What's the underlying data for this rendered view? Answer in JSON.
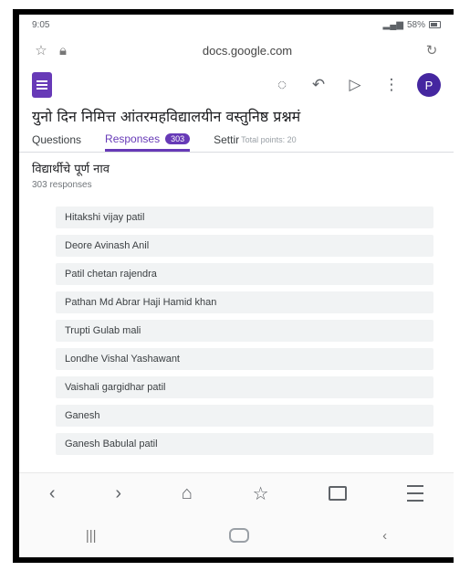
{
  "status_bar": {
    "time": "9:05",
    "right": "58%"
  },
  "browser": {
    "url": "docs.google.com"
  },
  "toolbar": {
    "avatar_letter": "P"
  },
  "form": {
    "title": "युनो दिन निमित्त आंतरमहविद्यालयीन वस्तुनिष्ठ प्रश्नमं"
  },
  "tabs": {
    "questions": "Questions",
    "responses": "Responses",
    "response_count": "303",
    "settings_cut": "Settir",
    "total_points": "Total points: 20"
  },
  "question": {
    "title": "विद्यार्थीचे पूर्ण नाव",
    "responses_label": "303 responses",
    "answers": [
      "Hitakshi vijay patil",
      "Deore Avinash Anil",
      "Patil chetan rajendra",
      "Pathan Md Abrar Haji Hamid khan",
      "Trupti Gulab mali",
      "Londhe Vishal Yashawant",
      "Vaishali gargidhar patil",
      "Ganesh",
      "Ganesh Babulal patil"
    ]
  },
  "icons": {
    "star": "star-icon",
    "lock": "lock-icon",
    "refresh": "refresh-icon",
    "palette": "palette-icon",
    "undo": "undo-icon",
    "send": "send-icon",
    "more": "more-vert-icon",
    "back": "back-arrow-icon",
    "forward": "forward-arrow-icon",
    "home": "home-icon",
    "bookmark": "bookmark-star-icon",
    "tabs": "tabs-icon",
    "menu": "menu-icon"
  },
  "colors": {
    "accent": "#673ab7",
    "avatar": "#4527a0",
    "notification": "#f28b00"
  }
}
